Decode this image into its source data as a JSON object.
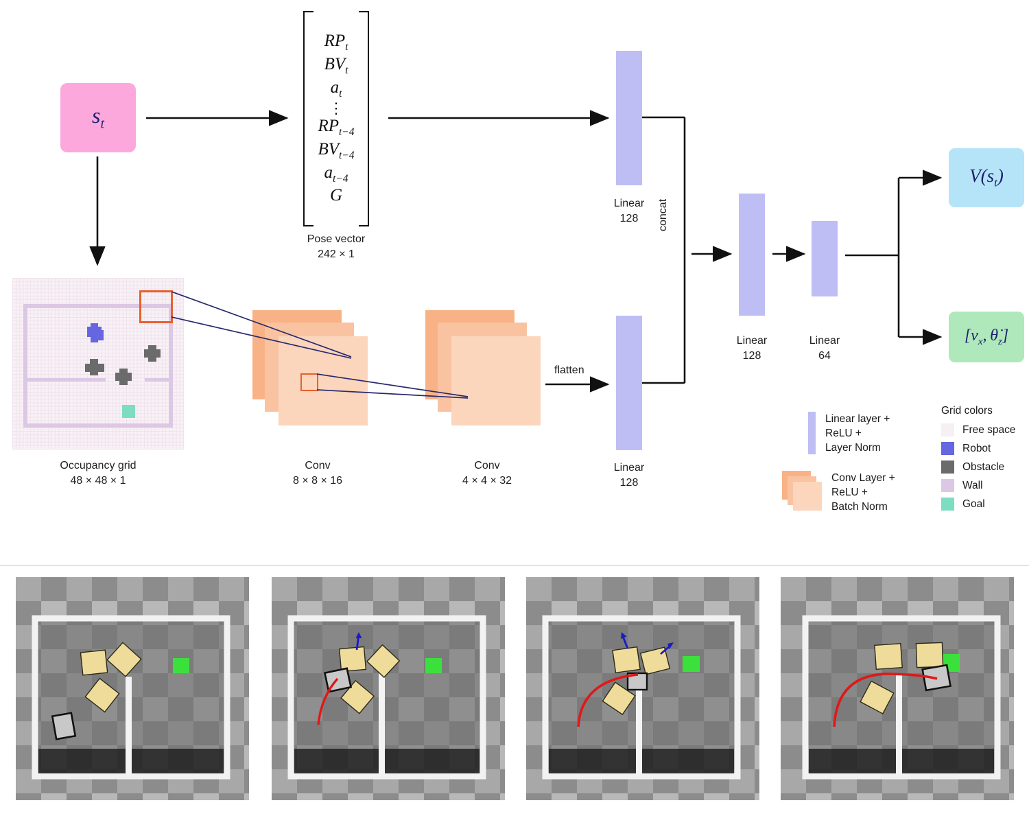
{
  "state": {
    "symbol": "s_t",
    "color": "#FCA8DC"
  },
  "pose_vector": {
    "rows": [
      "RP_t",
      "BV_t",
      "a_t",
      "⋮",
      "RP_{t-4}",
      "BV_{t-4}",
      "a_{t-4}",
      "G"
    ],
    "caption_line1": "Pose vector",
    "caption_line2": "242 × 1"
  },
  "occupancy_grid": {
    "caption_line1": "Occupancy grid",
    "caption_line2": "48 × 48 × 1",
    "highlight_color": "#E8602C",
    "projection_line_color": "#2A2A6E"
  },
  "conv_layers": [
    {
      "name": "Conv",
      "shape": "8 × 8 × 16"
    },
    {
      "name": "Conv",
      "shape": "4 × 4 × 32"
    }
  ],
  "linear_layers": {
    "pose_branch": {
      "name": "Linear",
      "units": "128"
    },
    "grid_branch": {
      "name": "Linear",
      "units": "128"
    },
    "merged_1": {
      "name": "Linear",
      "units": "128"
    },
    "merged_2": {
      "name": "Linear",
      "units": "64"
    }
  },
  "edge_labels": {
    "flatten": "flatten",
    "concat": "concat"
  },
  "outputs": {
    "value": {
      "symbol": "V(s_t)",
      "color": "#B5E3F7"
    },
    "action": {
      "symbol": "[v_x, θ̇_z]",
      "color": "#AEE8BB"
    }
  },
  "legend_network": [
    {
      "icon": "linear-layer-swatch",
      "lines": [
        "Linear layer +",
        "ReLU +",
        "Layer Norm"
      ]
    },
    {
      "icon": "conv-layer-swatch",
      "lines": [
        "Conv Layer +",
        "ReLU +",
        "Batch Norm"
      ]
    }
  ],
  "legend_grid": {
    "title": "Grid colors",
    "items": [
      {
        "label": "Free space",
        "color": "#F6EFF3"
      },
      {
        "label": "Robot",
        "color": "#6666E0"
      },
      {
        "label": "Obstacle",
        "color": "#6B6B6B"
      },
      {
        "label": "Wall",
        "color": "#DCC8E4"
      },
      {
        "label": "Goal",
        "color": "#7EDCC2"
      }
    ]
  },
  "simulation": {
    "frame_count": 4,
    "box_color": "#F0DC9A",
    "goal_color": "#3CE03C",
    "trajectory_color": "#E01818",
    "arrow_color": "#1A1AC8",
    "robot_color": "#C8C8C8"
  },
  "chart_data": {
    "type": "diagram",
    "title": "Actor-critic network architecture for robot push navigation",
    "nodes": [
      {
        "id": "state",
        "label": "s_t",
        "type": "input",
        "color": "#FCA8DC"
      },
      {
        "id": "pose",
        "label": "Pose vector 242 × 1",
        "type": "tensor"
      },
      {
        "id": "grid",
        "label": "Occupancy grid 48 × 48 × 1",
        "type": "tensor"
      },
      {
        "id": "lin_pose",
        "label": "Linear 128",
        "type": "linear",
        "units": 128
      },
      {
        "id": "conv1",
        "label": "Conv 8 × 8 × 16",
        "type": "conv",
        "channels": 16
      },
      {
        "id": "conv2",
        "label": "Conv 4 × 4 × 32",
        "type": "conv",
        "channels": 32
      },
      {
        "id": "lin_grid",
        "label": "Linear 128",
        "type": "linear",
        "units": 128
      },
      {
        "id": "lin_m1",
        "label": "Linear 128",
        "type": "linear",
        "units": 128
      },
      {
        "id": "lin_m2",
        "label": "Linear 64",
        "type": "linear",
        "units": 64
      },
      {
        "id": "value",
        "label": "V(s_t)",
        "type": "output",
        "color": "#B5E3F7"
      },
      {
        "id": "action",
        "label": "[v_x, θ̇_z]",
        "type": "output",
        "color": "#AEE8BB"
      }
    ],
    "edges": [
      {
        "from": "state",
        "to": "pose",
        "label": ""
      },
      {
        "from": "state",
        "to": "grid",
        "label": ""
      },
      {
        "from": "pose",
        "to": "lin_pose",
        "label": ""
      },
      {
        "from": "grid",
        "to": "conv1",
        "label": ""
      },
      {
        "from": "conv1",
        "to": "conv2",
        "label": ""
      },
      {
        "from": "conv2",
        "to": "lin_grid",
        "label": "flatten"
      },
      {
        "from": "lin_pose",
        "to": "lin_m1",
        "label": "concat"
      },
      {
        "from": "lin_grid",
        "to": "lin_m1",
        "label": "concat"
      },
      {
        "from": "lin_m1",
        "to": "lin_m2",
        "label": ""
      },
      {
        "from": "lin_m2",
        "to": "value",
        "label": ""
      },
      {
        "from": "lin_m2",
        "to": "action",
        "label": ""
      }
    ]
  }
}
